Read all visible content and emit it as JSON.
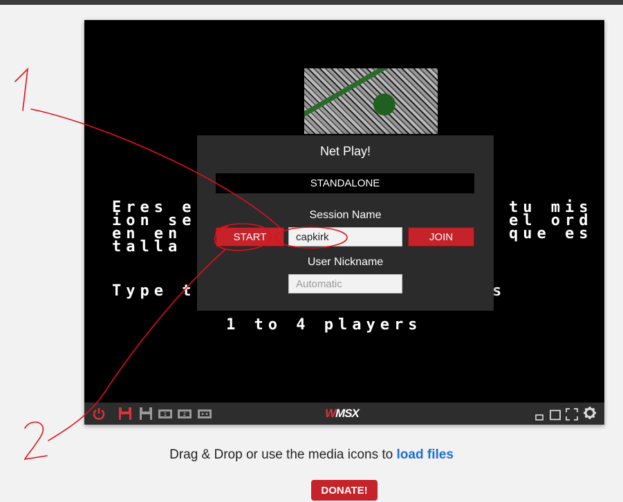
{
  "emulator": {
    "screen_lines": {
      "intro_left": "Eres e\nion se\nen en\ntalla",
      "intro_right": "tu mis\nel ord\nque es",
      "type_left": "Type t",
      "type_right": "s",
      "players": "1 to 4 players"
    },
    "toolbar": {
      "logo_prefix": "W",
      "logo_main": "MSX",
      "icons": [
        "power-icon",
        "disk-a-icon",
        "disk-b-icon",
        "cartridge-1-icon",
        "cartridge-2-icon",
        "tape-icon",
        "window-small-icon",
        "window-icon",
        "fullscreen-icon",
        "settings-gear-icon"
      ]
    }
  },
  "netplay": {
    "title": "Net Play!",
    "mode": "STANDALONE",
    "session_label": "Session Name",
    "start_label": "START",
    "session_value": "capkirk",
    "join_label": "JOIN",
    "nickname_label": "User Nickname",
    "nickname_placeholder": "Automatic"
  },
  "footer": {
    "help_prefix": "Drag & Drop or use the media icons to ",
    "help_link": "load files",
    "donate": "DONATE!"
  },
  "annotations": {
    "label_1": "1",
    "label_2": "2",
    "color": "#e0101a"
  }
}
